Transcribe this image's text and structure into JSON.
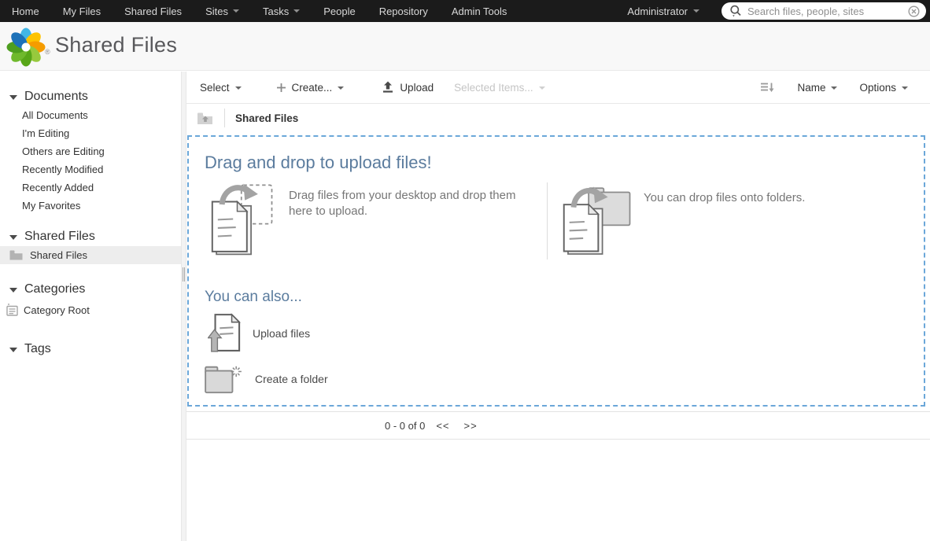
{
  "topnav": {
    "items": [
      "Home",
      "My Files",
      "Shared Files",
      "Sites",
      "Tasks",
      "People",
      "Repository",
      "Admin Tools"
    ],
    "user_menu": "Administrator",
    "search": {
      "placeholder": "Search files, people, sites"
    }
  },
  "header": {
    "title": "Shared Files",
    "registered": "®"
  },
  "sidebar": {
    "documents": {
      "label": "Documents",
      "items": [
        "All Documents",
        "I'm Editing",
        "Others are Editing",
        "Recently Modified",
        "Recently Added",
        "My Favorites"
      ]
    },
    "shared_files": {
      "label": "Shared Files",
      "selected_item": "Shared Files"
    },
    "categories": {
      "label": "Categories",
      "root": "Category Root"
    },
    "tags": {
      "label": "Tags"
    }
  },
  "toolbar": {
    "select": "Select",
    "create": "Create...",
    "upload": "Upload",
    "selected_items": "Selected Items...",
    "sort_by": "Name",
    "options": "Options"
  },
  "breadcrumb": {
    "current": "Shared Files"
  },
  "dropzone": {
    "title": "Drag and drop to upload files!",
    "desktop_hint": "Drag files from your desktop and drop them here to upload.",
    "folders_hint": "You can drop files onto folders.",
    "also": "You can also...",
    "upload_files": "Upload files",
    "create_folder": "Create a folder"
  },
  "pagination": {
    "range": "0 - 0 of 0",
    "prev": "<<",
    "next": ">>"
  },
  "colors": {
    "navbar_bg": "#1b1b1b",
    "header_bg": "#f8f8f8",
    "accent_blue": "#5b7c9e",
    "dashed_border": "#6ba7d9",
    "selected_row_bg": "#ededed"
  }
}
